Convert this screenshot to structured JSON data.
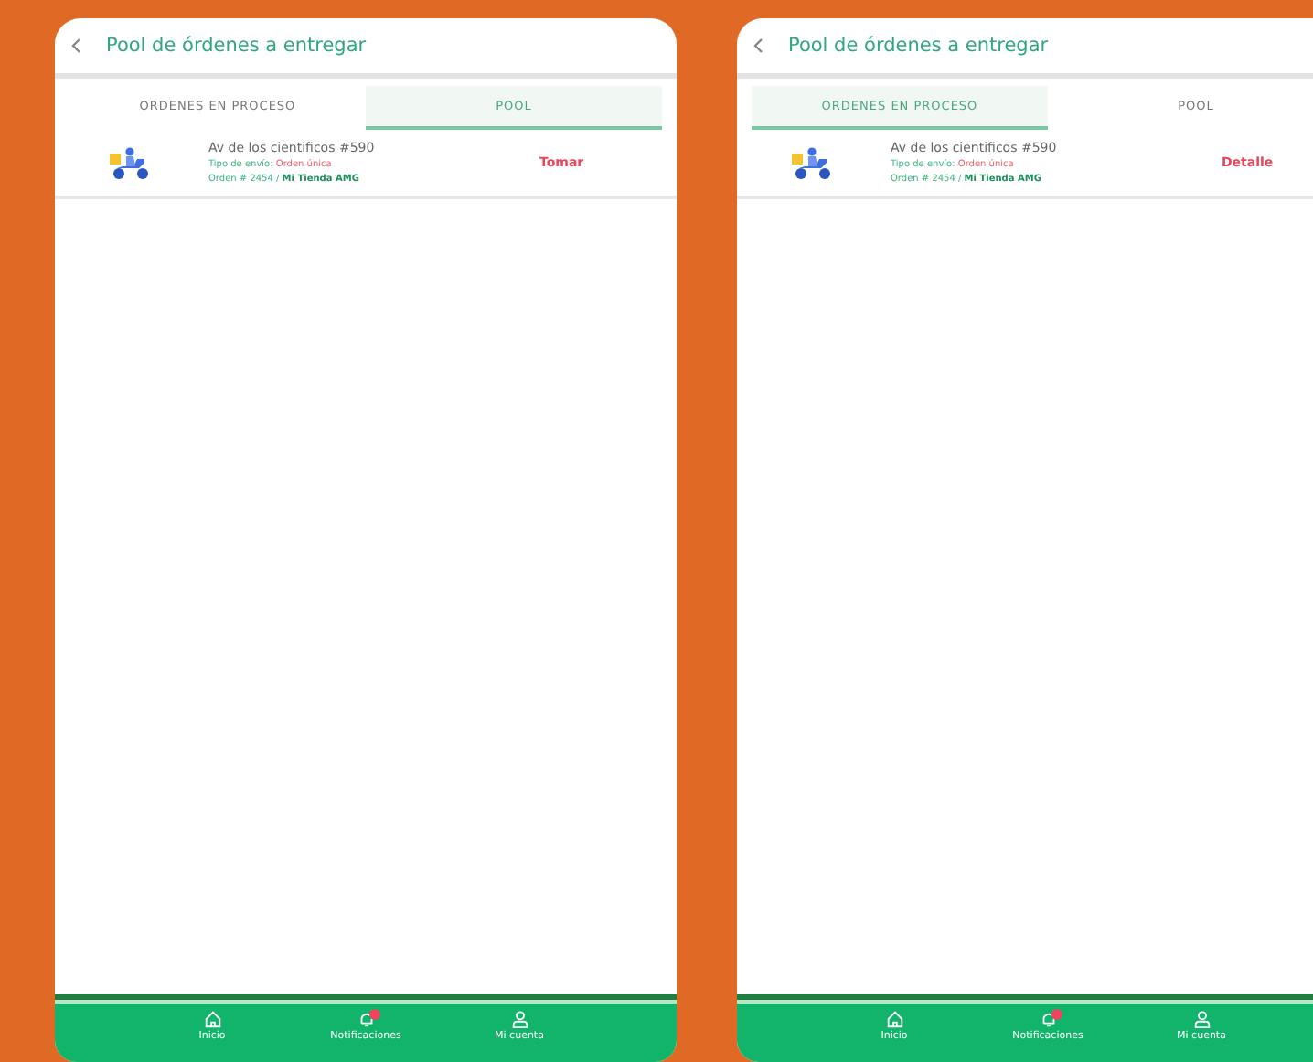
{
  "screens": [
    {
      "title": "Pool de órdenes a entregar",
      "tabs": [
        {
          "label": "ORDENES EN PROCESO",
          "selected": false
        },
        {
          "label": "POOL",
          "selected": true
        }
      ],
      "orders": [
        {
          "address": "Av de los cientificos #590",
          "type_label": "Tipo de envío:",
          "type_value": "Orden única",
          "order_line": "Orden # 2454 / **Mi Tienda AMG**",
          "action": "Tomar"
        }
      ],
      "nav": [
        {
          "kind": "home",
          "label": "Inicio"
        },
        {
          "kind": "bell",
          "label": "Notificaciones",
          "badge": true
        },
        {
          "kind": "user",
          "label": "Mi cuenta"
        }
      ]
    },
    {
      "title": "Pool de órdenes a entregar",
      "tabs": [
        {
          "label": "ORDENES EN PROCESO",
          "selected": true
        },
        {
          "label": "POOL",
          "selected": false
        }
      ],
      "orders": [
        {
          "address": "Av de los cientificos #590",
          "type_label": "Tipo de envío:",
          "type_value": "Orden única",
          "order_line": "Orden # 2454 / **Mi Tienda AMG**",
          "action": "Detalle"
        }
      ],
      "nav": [
        {
          "kind": "home",
          "label": "Inicio"
        },
        {
          "kind": "bell",
          "label": "Notificaciones",
          "badge": true
        },
        {
          "kind": "user",
          "label": "Mi cuenta"
        }
      ]
    }
  ]
}
